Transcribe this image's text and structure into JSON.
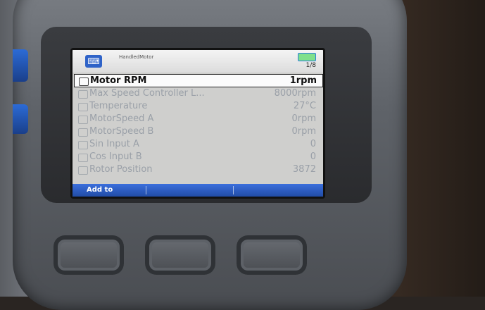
{
  "header": {
    "app_title": "HandledMotor",
    "page_indicator": "1/8"
  },
  "params": [
    {
      "label": "Motor RPM",
      "value": "1rpm",
      "selected": true
    },
    {
      "label": "Max Speed Controller L...",
      "value": "8000rpm",
      "selected": false
    },
    {
      "label": "Temperature",
      "value": "27°C",
      "selected": false
    },
    {
      "label": "MotorSpeed A",
      "value": "0rpm",
      "selected": false
    },
    {
      "label": "MotorSpeed B",
      "value": "0rpm",
      "selected": false
    },
    {
      "label": "Sin Input A",
      "value": "0",
      "selected": false
    },
    {
      "label": "Cos Input B",
      "value": "0",
      "selected": false
    },
    {
      "label": "Rotor Position",
      "value": "3872",
      "selected": false
    }
  ],
  "softkeys": [
    "Add to",
    "",
    ""
  ],
  "colors": {
    "accent": "#2f63c8",
    "screen_bg": "#cfcfcd",
    "softkey_bar": "#2f5ec2",
    "battery_fill": "#7fe08b"
  },
  "icons": {
    "app": "handheld-device-icon",
    "battery": "battery-icon",
    "param": "parameter-icon"
  }
}
